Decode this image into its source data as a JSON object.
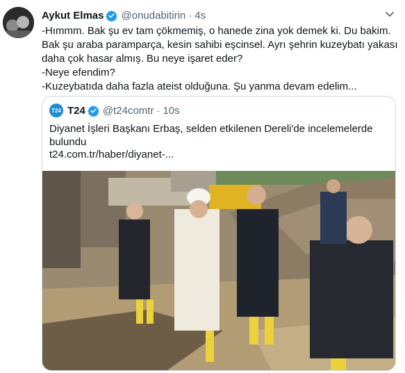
{
  "tweet": {
    "author_name": "Aykut Elmas",
    "author_handle": "@onudabitirin",
    "separator": "·",
    "time": "4s",
    "lines": [
      "-Hımmm. Bak şu ev tam çökmemiş, o hanede zina yok demek ki. Du bakim.",
      "Bak şu araba paramparça, kesin sahibi eşcinsel. Ayrı şehrin kuzeybatı yakası",
      "daha çok hasar almış. Bu neye işaret eder?",
      "-Neye efendim?",
      "-Kuzeybatıda daha fazla ateist olduğuna. Şu yanma devam edelim..."
    ]
  },
  "quoted": {
    "logo_text": "T24",
    "author_name": "T24",
    "author_handle": "@t24comtr",
    "separator": "·",
    "time": "10s",
    "text": "Diyanet İşleri Başkanı Erbaş, selden etkilenen Dereli'de incelemelerde bulundu",
    "link": "t24.com.tr/haber/diyanet-..."
  },
  "icons": {
    "verified": "verified-badge-icon",
    "caret": "chevron-down-icon"
  },
  "colors": {
    "verified": "#1d9bf0",
    "secondary_text": "#536471",
    "border": "#cfd9de",
    "t24_logo": "#1a8cd8"
  }
}
